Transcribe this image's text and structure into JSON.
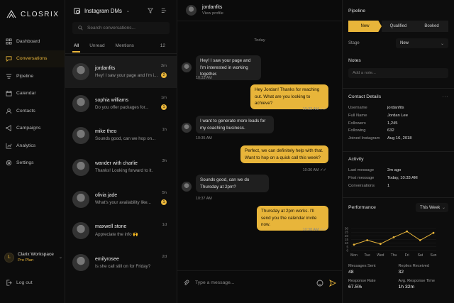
{
  "brand": {
    "name": "CLOSRIX"
  },
  "nav": [
    {
      "label": "Dashboard",
      "icon": "grid-icon"
    },
    {
      "label": "Conversations",
      "icon": "chat-icon",
      "active": true
    },
    {
      "label": "Pipeline",
      "icon": "pipeline-icon"
    },
    {
      "label": "Calendar",
      "icon": "calendar-icon"
    },
    {
      "label": "Contacts",
      "icon": "contacts-icon"
    },
    {
      "label": "Campaigns",
      "icon": "megaphone-icon"
    },
    {
      "label": "Analytics",
      "icon": "analytics-icon"
    },
    {
      "label": "Settings",
      "icon": "gear-icon"
    }
  ],
  "workspace": {
    "initial": "L",
    "name": "Clarix Workspace",
    "plan": "Pro Plan"
  },
  "logout": "Log out",
  "inbox": {
    "title": "Instagram DMs",
    "search_placeholder": "Search conversations...",
    "tabs": [
      "All",
      "Unread",
      "Mentions"
    ],
    "count": "12",
    "conversations": [
      {
        "name": "jordanfits",
        "preview": "Hey! I saw your page and I'm i...",
        "time": "2m",
        "badge": "2",
        "active": true
      },
      {
        "name": "sophia williams",
        "preview": "Do you offer packages for...",
        "time": "1m",
        "badge": "1"
      },
      {
        "name": "mike theo",
        "preview": "Sounds good, can we hop on...",
        "time": "1h",
        "badge": ""
      },
      {
        "name": "wander with charlie",
        "preview": "Thanks! Looking forward to it.",
        "time": "3h",
        "badge": ""
      },
      {
        "name": "olivia jade",
        "preview": "What's your availability like...",
        "time": "5h",
        "badge": "1"
      },
      {
        "name": "maxwell stone",
        "preview": "Appreciate the info 🙌",
        "time": "1d",
        "badge": ""
      },
      {
        "name": "emilyrosee",
        "preview": "Is she call still on for Friday?",
        "time": "2d",
        "badge": ""
      }
    ]
  },
  "chat": {
    "name": "jordanfits",
    "subtitle": "View profile",
    "day": "Today",
    "messages": [
      {
        "dir": "in",
        "text": "Hey! I saw your page and I'm interested in working together.",
        "time": "10:33 AM"
      },
      {
        "dir": "out",
        "text": "Hey Jordan! Thanks for reaching out. What are you looking to achieve?",
        "time": "10:33 AM"
      },
      {
        "dir": "in",
        "text": "I want to generate more leads for my coaching business.",
        "time": "10:35 AM"
      },
      {
        "dir": "out",
        "text": "Perfect, we can definitely help with that. Want to hop on a quick call this week?",
        "time": "10:36 AM"
      },
      {
        "dir": "in",
        "text": "Sounds good, can we do Thursday at 2pm?",
        "time": "10:37 AM"
      },
      {
        "dir": "out",
        "text": "Thursday at 2pm works. I'll send you the calendar invite now.",
        "time": "10:38 AM"
      }
    ],
    "composer_placeholder": "Type a message..."
  },
  "panel": {
    "pipeline": {
      "title": "Pipeline",
      "stages": [
        "New",
        "Qualified",
        "Booked"
      ],
      "stage_label": "Stage",
      "stage_value": "New"
    },
    "notes": {
      "title": "Notes",
      "placeholder": "Add a note..."
    },
    "contact": {
      "title": "Contact Details",
      "fields": [
        {
          "k": "Username",
          "v": "jordanfits"
        },
        {
          "k": "Full Name",
          "v": "Jordan Lee"
        },
        {
          "k": "Followers",
          "v": "1,245"
        },
        {
          "k": "Following",
          "v": "632"
        },
        {
          "k": "Joined Instagram",
          "v": "Aug 16, 2018"
        }
      ]
    },
    "activity": {
      "title": "Activity",
      "fields": [
        {
          "k": "Last message",
          "v": "2m ago"
        },
        {
          "k": "First message",
          "v": "Today, 10:33 AM"
        },
        {
          "k": "Conversations",
          "v": "1"
        }
      ]
    },
    "performance": {
      "title": "Performance",
      "range": "This Week"
    },
    "stats": [
      {
        "label": "Messages Sent",
        "value": "48"
      },
      {
        "label": "Replies Received",
        "value": "32"
      },
      {
        "label": "Response Rate",
        "value": "67.5%"
      },
      {
        "label": "Avg. Response Time",
        "value": "1h 32m"
      }
    ]
  },
  "chart_data": {
    "type": "line",
    "categories": [
      "Mon",
      "Tue",
      "Wed",
      "Thu",
      "Fri",
      "Sat",
      "Sun"
    ],
    "values": [
      8,
      14,
      9,
      18,
      26,
      14,
      24
    ],
    "ylim": [
      0,
      30
    ],
    "yticks": [
      "0",
      "5",
      "10",
      "15",
      "20",
      "25",
      "30"
    ],
    "color": "#e8b53a",
    "grid": true
  }
}
